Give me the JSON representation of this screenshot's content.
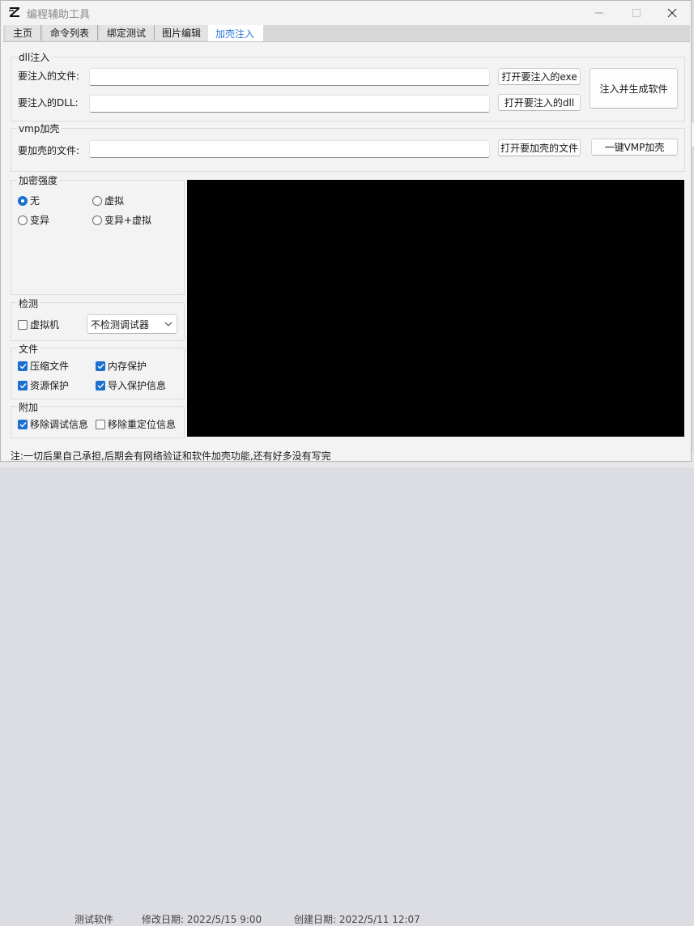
{
  "window": {
    "title": "编程辅助工具"
  },
  "tabs": [
    {
      "label": "主页"
    },
    {
      "label": "命令列表"
    },
    {
      "label": "绑定测试"
    },
    {
      "label": "图片编辑"
    },
    {
      "label": "加壳注入",
      "active": true
    }
  ],
  "dll_inject": {
    "group_label": "dll注入",
    "file_label": "要注入的文件:",
    "file_value": "",
    "dll_label": "要注入的DLL:",
    "dll_value": "",
    "open_exe_button": "打开要注入的exe",
    "open_dll_button": "打开要注入的dll",
    "inject_button": "注入并生成软件"
  },
  "vmp": {
    "group_label": "vmp加壳",
    "file_label": "要加壳的文件:",
    "file_value": "",
    "open_button": "打开要加壳的文件",
    "one_click_button": "一键VMP加壳"
  },
  "encryption": {
    "group_label": "加密强度",
    "options": [
      {
        "label": "无",
        "selected": true
      },
      {
        "label": "虚拟",
        "selected": false
      },
      {
        "label": "变异",
        "selected": false
      },
      {
        "label": "变异+虚拟",
        "selected": false
      }
    ]
  },
  "detection": {
    "group_label": "检测",
    "vm_label": "虚拟机",
    "vm_checked": false,
    "debugger_select": "不检测调试器"
  },
  "file_opts": {
    "group_label": "文件",
    "items": [
      {
        "label": "压缩文件",
        "checked": true
      },
      {
        "label": "内存保护",
        "checked": true
      },
      {
        "label": "资源保护",
        "checked": true
      },
      {
        "label": "导入保护信息",
        "checked": true
      }
    ]
  },
  "extra": {
    "group_label": "附加",
    "items": [
      {
        "label": "移除调试信息",
        "checked": true
      },
      {
        "label": "移除重定位信息",
        "checked": false
      }
    ]
  },
  "footer_note": "注:一切后果自己承担,后期会有网络验证和软件加壳功能,还有好多没有写完",
  "background_fragment": {
    "a": "测试软件",
    "b": "修改日期: 2022/5/15 9:00",
    "c": "创建日期: 2022/5/11 12:07"
  },
  "colors": {
    "accent": "#1a6fd1",
    "console_bg": "#000000"
  },
  "icons": {
    "app": "z-logo-icon",
    "minimize": "minimize-icon",
    "maximize": "maximize-icon",
    "close": "close-icon",
    "dropdown": "chevron-down-icon"
  }
}
